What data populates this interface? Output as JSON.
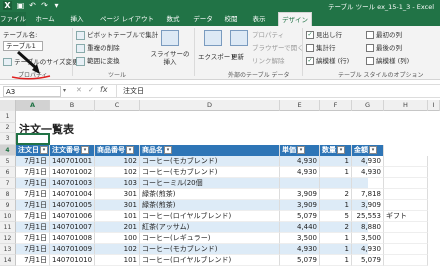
{
  "window": {
    "title": "テーブル ツール    ex_15-1_3 - Excel"
  },
  "tabs": [
    "ファイル",
    "ホーム",
    "挿入",
    "ページ レイアウト",
    "数式",
    "データ",
    "校閲",
    "表示",
    "デザイン"
  ],
  "contextual_tab_group": "テーブル ツール",
  "ribbon": {
    "table_name_label": "テーブル名:",
    "table_name_value": "テーブル1",
    "resize_table": "テーブルのサイズ変更",
    "properties_group": "プロパティ",
    "summarize_pivot": "ピボットテーブルで集計",
    "remove_duplicates": "重複の削除",
    "convert_to_range": "範囲に変換",
    "insert_slicer": "スライサーの挿入",
    "tools_group": "ツール",
    "export": "エクスポート",
    "refresh": "更新",
    "properties_btn": "プロパティ",
    "open_browser": "ブラウザーで開く",
    "unlink": "リンク解除",
    "external_group": "外部のテーブル データ",
    "header_row": "見出し行",
    "total_row": "集計行",
    "banded_rows": "縞模様 (行)",
    "first_column": "最初の列",
    "last_column": "最後の列",
    "banded_columns": "縞模様 (列)",
    "style_options_group": "テーブル スタイルのオプション",
    "checks": {
      "header_row": true,
      "total_row": false,
      "banded_rows": true,
      "first_column": false,
      "last_column": false,
      "banded_columns": false
    }
  },
  "formula_bar": {
    "name_box": "A3",
    "fx": "fx",
    "content": "注文日"
  },
  "columns": [
    "A",
    "B",
    "C",
    "D",
    "E",
    "F",
    "G",
    "H",
    "I"
  ],
  "rows": [
    "1",
    "2",
    "3",
    "4",
    "5",
    "6",
    "7",
    "8",
    "9",
    "10",
    "11",
    "12",
    "13",
    "14"
  ],
  "sheet": {
    "title": "注文一覧表",
    "headers": [
      "注文日",
      "注文番号",
      "商品番号",
      "商品名",
      "単価",
      "数量",
      "金額"
    ],
    "data": [
      [
        "7月1日",
        "140701001",
        "102",
        "コーヒー(モカブレンド)",
        "4,930",
        "1",
        "4,930",
        ""
      ],
      [
        "7月1日",
        "140701002",
        "102",
        "コーヒー(モカブレンド)",
        "4,930",
        "1",
        "4,930",
        ""
      ],
      [
        "7月1日",
        "140701003",
        "103",
        "コーヒーミル(20個",
        "",
        "",
        "",
        ""
      ],
      [
        "7月1日",
        "140701004",
        "301",
        "緑茶(煎茶)",
        "3,909",
        "2",
        "7,818",
        ""
      ],
      [
        "7月1日",
        "140701005",
        "301",
        "緑茶(煎茶)",
        "3,909",
        "1",
        "3,909",
        ""
      ],
      [
        "7月1日",
        "140701006",
        "101",
        "コーヒー(ロイヤルブレンド)",
        "5,079",
        "5",
        "25,553",
        "ギフト"
      ],
      [
        "7月1日",
        "140701007",
        "201",
        "紅茶(アッサム)",
        "4,440",
        "2",
        "8,880",
        ""
      ],
      [
        "7月1日",
        "140701008",
        "100",
        "コーヒー(レギュラー)",
        "3,500",
        "1",
        "3,500",
        ""
      ],
      [
        "7月1日",
        "140701009",
        "102",
        "コーヒー(モカブレンド)",
        "4,930",
        "1",
        "4,930",
        ""
      ],
      [
        "7月1日",
        "140701010",
        "101",
        "コーヒー(ロイヤルブレンド)",
        "5,079",
        "1",
        "5,079",
        ""
      ]
    ]
  }
}
